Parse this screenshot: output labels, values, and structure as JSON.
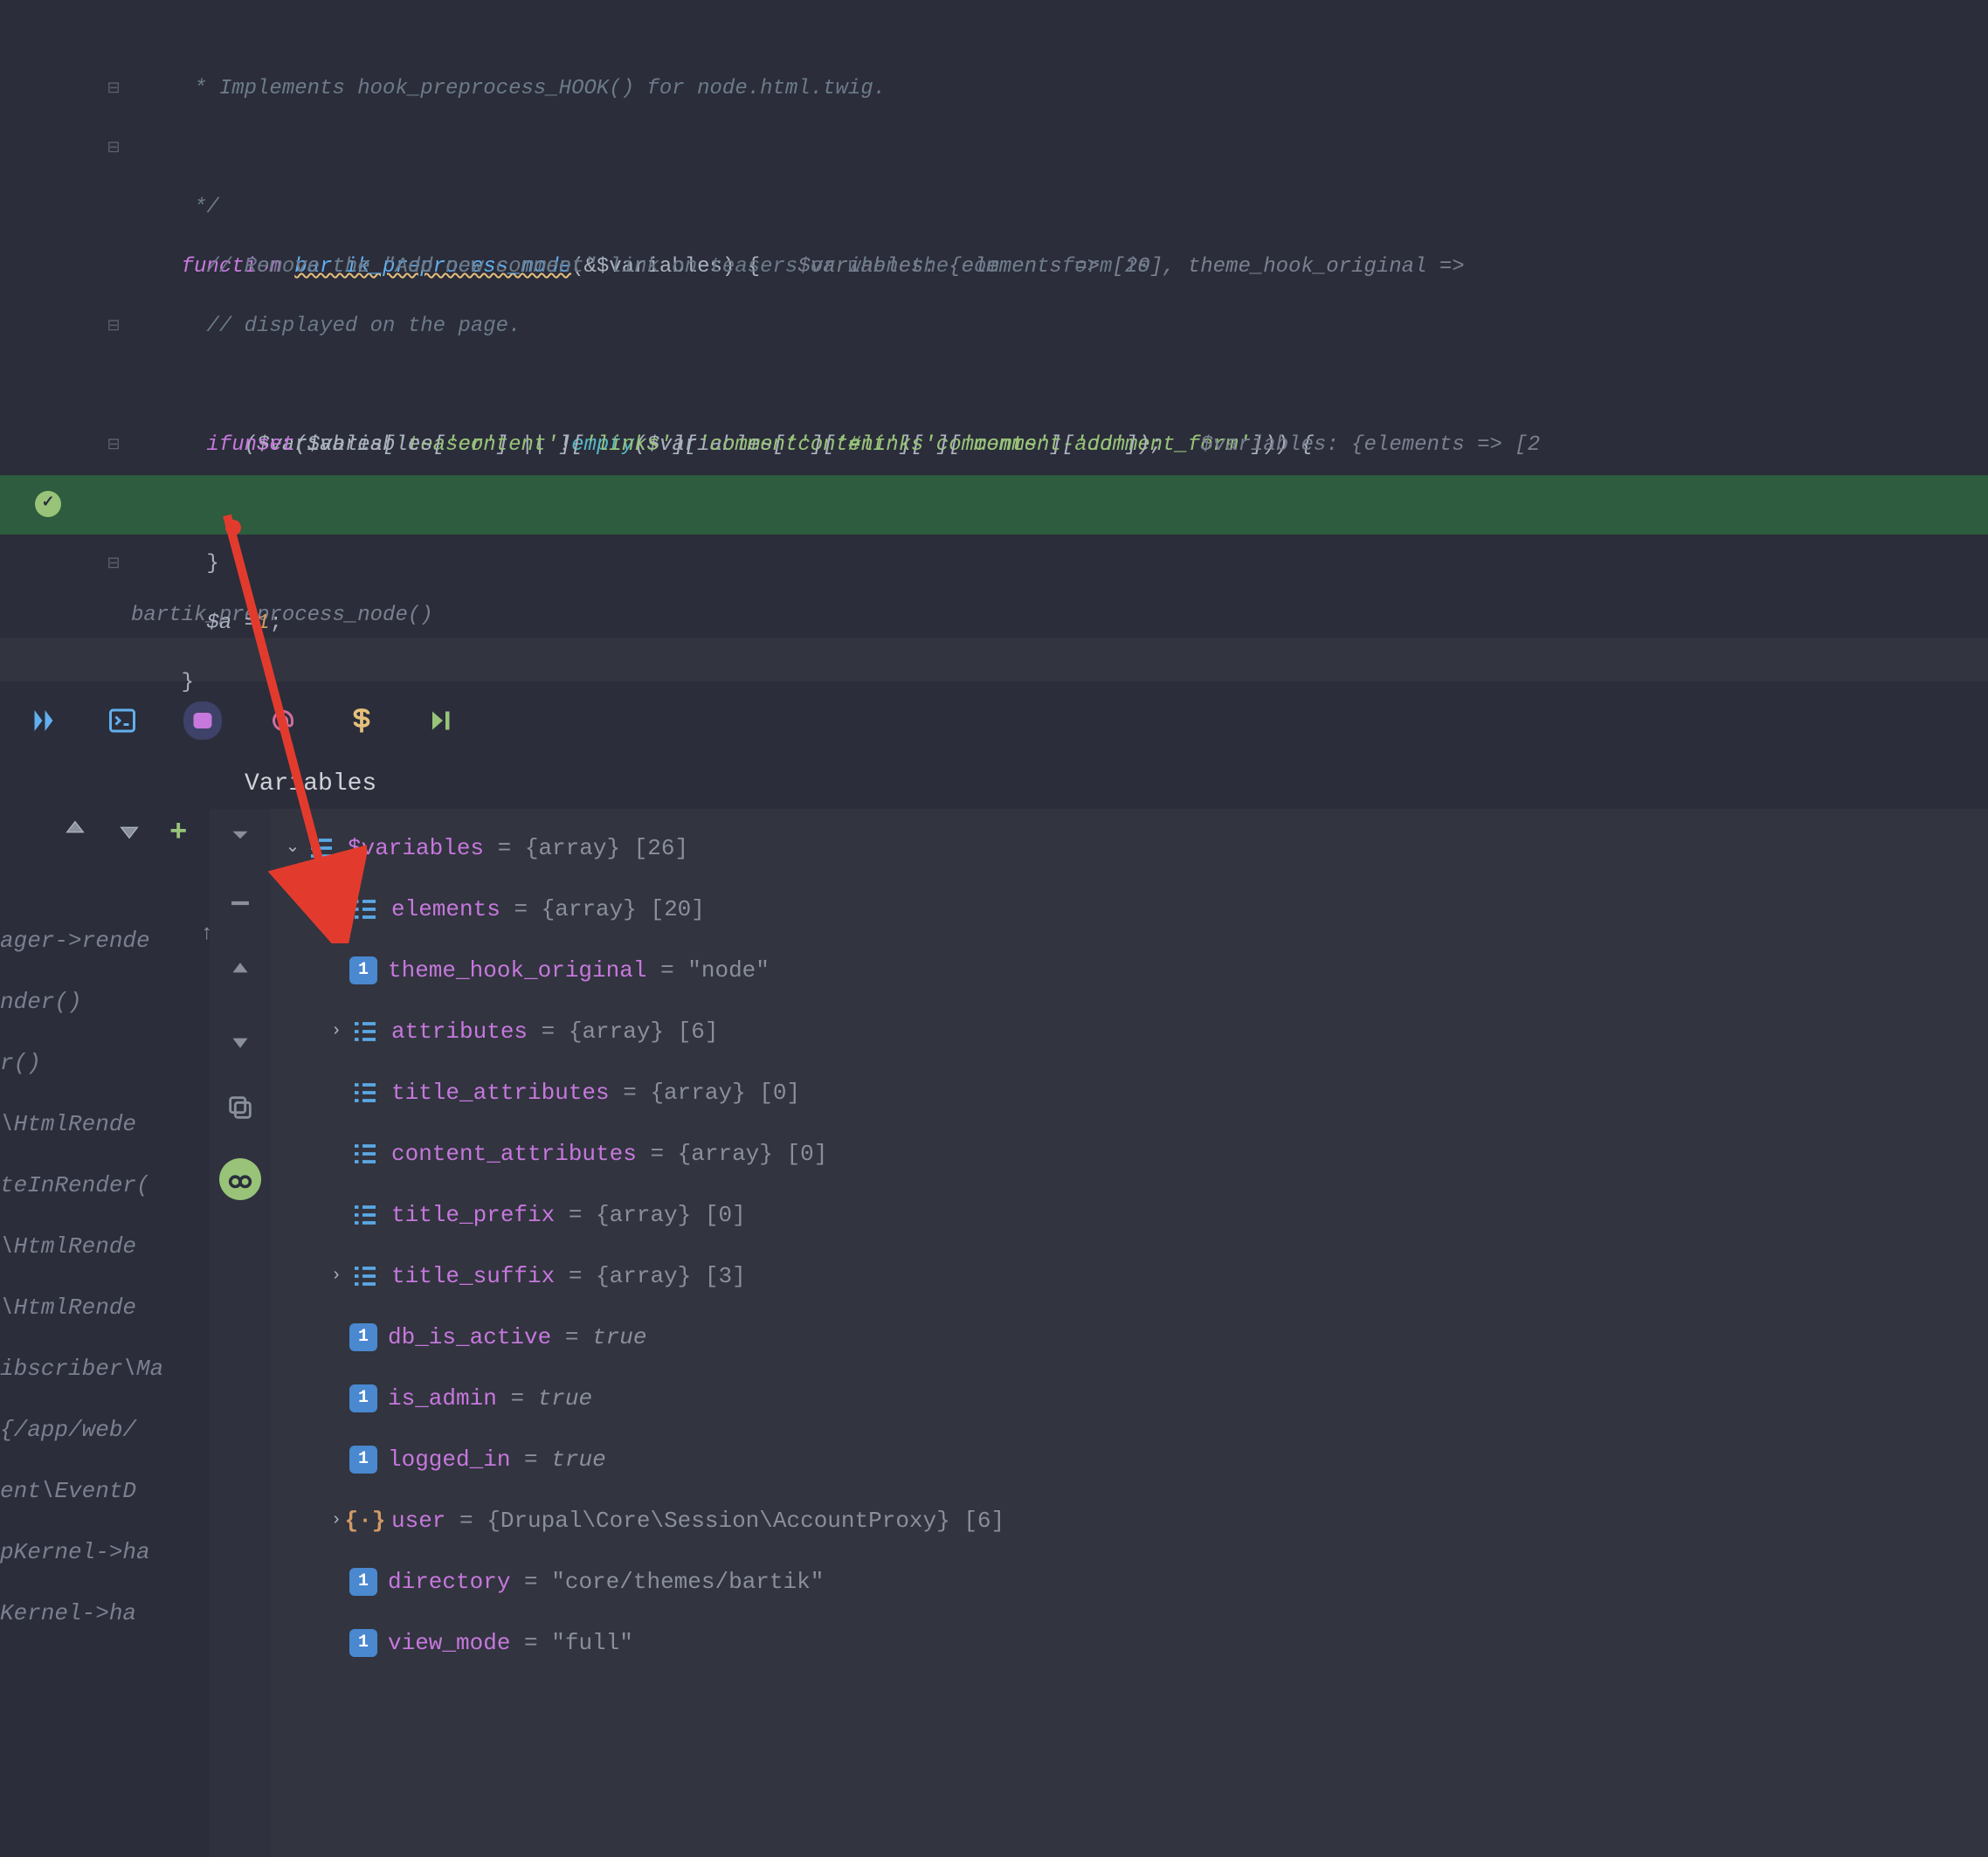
{
  "editor": {
    "lines": {
      "l1": " * Implements hook_preprocess_HOOK() for node.html.twig.",
      "l2": " */",
      "l3_kw": "function",
      "l3_fn": "bartik_preprocess_node",
      "l3_rest": "(&$variables) {",
      "l3_hint": "$variables: {elements => [20], theme_hook_original =>",
      "l4": "  // Remove the \"Add new comment\" link on teasers or when the comment form is",
      "l5": "  // displayed on the page.",
      "l6_if": "if",
      "l6_a": " ($variables[",
      "l6_s1": "'teaser'",
      "l6_b": "] || !",
      "l6_emp": "empty",
      "l6_c": "($variables[",
      "l6_s2": "'content'",
      "l6_d": "][",
      "l6_s3": "'comments'",
      "l6_e": "][",
      "l6_s4": "'comment_form'",
      "l6_f": "])) {",
      "l7_unset": "unset",
      "l7_a": "($variables[",
      "l7_s1": "'content'",
      "l7_b": "][",
      "l7_s2": "'links'",
      "l7_c": "][",
      "l7_s3": "'comment'",
      "l7_d": "][",
      "l7_s4": "'#links'",
      "l7_e": "][",
      "l7_s5": "'comment-add'",
      "l7_f": "]);",
      "l7_hint": "$variables: {elements => [2",
      "l8": "  }",
      "l9_a": "  $a =",
      "l9_b": "1",
      "l9_c": ";",
      "l10": "}",
      "l11": "bartik_preprocess_node()"
    }
  },
  "panel_title": "Variables",
  "stack": [
    "ager->rende",
    "nder()",
    "r()",
    "\\HtmlRende",
    "teInRender(",
    "\\HtmlRende",
    "\\HtmlRende",
    "ibscriber\\Ma",
    "{/app/web/",
    "ent\\EventD",
    "pKernel->ha",
    "Kernel->ha"
  ],
  "variables": {
    "root": {
      "name": "$variables",
      "type": "{array} [26]"
    },
    "children": [
      {
        "exp": true,
        "icon": "array",
        "name": "elements",
        "val": "= {array} [20]"
      },
      {
        "exp": false,
        "icon": "string",
        "name": "theme_hook_original",
        "val": "= \"node\""
      },
      {
        "exp": true,
        "icon": "array",
        "name": "attributes",
        "val": "= {array} [6]"
      },
      {
        "exp": false,
        "icon": "array",
        "name": "title_attributes",
        "val": "= {array} [0]"
      },
      {
        "exp": false,
        "icon": "array",
        "name": "content_attributes",
        "val": "= {array} [0]"
      },
      {
        "exp": false,
        "icon": "array",
        "name": "title_prefix",
        "val": "= {array} [0]"
      },
      {
        "exp": true,
        "icon": "array",
        "name": "title_suffix",
        "val": "= {array} [3]"
      },
      {
        "exp": false,
        "icon": "string",
        "name": "db_is_active",
        "val": "= ",
        "bool": "true"
      },
      {
        "exp": false,
        "icon": "string",
        "name": "is_admin",
        "val": "= ",
        "bool": "true"
      },
      {
        "exp": false,
        "icon": "string",
        "name": "logged_in",
        "val": "= ",
        "bool": "true"
      },
      {
        "exp": true,
        "icon": "object",
        "name": "user",
        "val": "= {Drupal\\Core\\Session\\AccountProxy} [6]"
      },
      {
        "exp": false,
        "icon": "string",
        "name": "directory",
        "val": "= \"core/themes/bartik\""
      },
      {
        "exp": false,
        "icon": "string",
        "name": "view_mode",
        "val": "= \"full\""
      }
    ]
  }
}
